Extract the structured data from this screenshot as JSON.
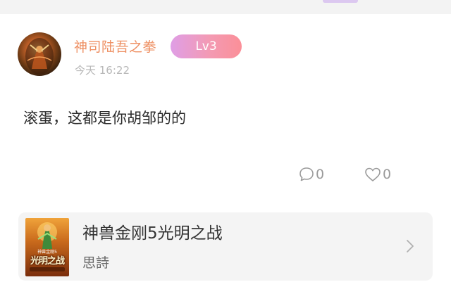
{
  "comment": {
    "author": {
      "name": "神司陆吾之拳",
      "level": "Lv3",
      "avatar_icon": "avatar-warrior-portrait"
    },
    "time": "今天 16:22",
    "text": "滚蛋，这都是你胡邹的的",
    "actions": {
      "reply_count": "0",
      "reply_icon": "comment-bubble-icon",
      "like_count": "0",
      "like_icon": "heart-icon"
    }
  },
  "book_card": {
    "title": "神兽金刚5光明之战",
    "author": "思詩",
    "cover": {
      "title": "光明之战",
      "subtitle": "神兽金刚5"
    },
    "chevron_icon": "chevron-right-icon"
  },
  "colors": {
    "username": "#ee8f62",
    "badge_gradient_start": "#df9ee6",
    "badge_gradient_end": "#fb8f98",
    "timestamp": "#b8b8b8",
    "card_background": "#f4f4f4"
  }
}
